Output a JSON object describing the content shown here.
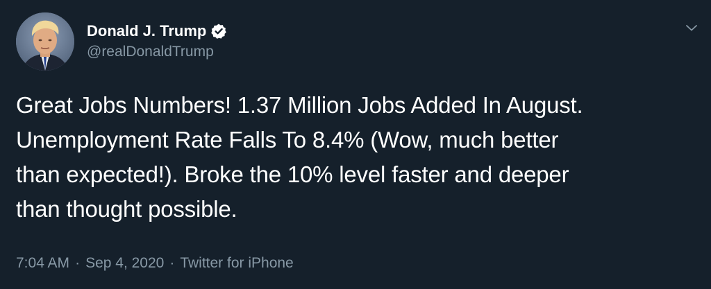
{
  "author": {
    "display_name": "Donald J. Trump",
    "handle": "@realDonaldTrump",
    "verified": true,
    "verified_badge_icon": "verified-badge-icon",
    "avatar_icon": "avatar-photo"
  },
  "tweet": {
    "text": "Great Jobs Numbers! 1.37 Million Jobs Added In August.\nUnemployment Rate Falls To 8.4% (Wow, much better\nthan expected!). Broke the 10% level faster and deeper\nthan thought possible."
  },
  "meta": {
    "time": "7:04 AM",
    "separator": "·",
    "date": "Sep 4, 2020",
    "source": "Twitter for iPhone"
  },
  "menu": {
    "icon": "chevron-down-icon"
  },
  "colors": {
    "background": "#15202b",
    "primary_text": "#ffffff",
    "secondary_text": "#8899a6"
  }
}
